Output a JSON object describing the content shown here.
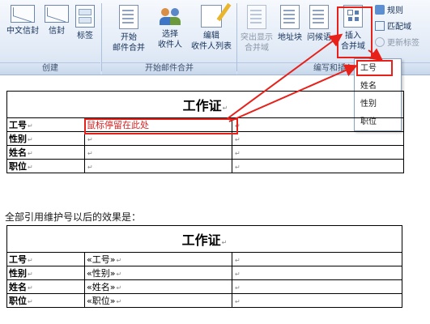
{
  "ribbon": {
    "groups": {
      "create": "创建",
      "start_merge": "开始邮件合并",
      "write_insert": "编写和插入"
    },
    "buttons": {
      "cn_envelope": "中文信封",
      "envelope": "信封",
      "labels": "标签",
      "start_merge": [
        "开始",
        "邮件合并"
      ],
      "select_recipients": [
        "选择",
        "收件人"
      ],
      "edit_recipients": [
        "编辑",
        "收件人列表"
      ],
      "highlight_fields": [
        "突出显示",
        "合并域"
      ],
      "address_block": "地址块",
      "greeting_line": "问候语",
      "insert_field": [
        "插入",
        "合并域"
      ]
    },
    "small_buttons": {
      "rules": "规则",
      "match_fields": "匹配域",
      "update_labels": "更新标签"
    }
  },
  "dropdown": {
    "items": [
      "工号",
      "姓名",
      "性别",
      "职位"
    ]
  },
  "table1": {
    "title": "工作证",
    "rows": [
      {
        "label": "工号",
        "value": "鼠标停留在此处"
      },
      {
        "label": "性别",
        "value": ""
      },
      {
        "label": "姓名",
        "value": ""
      },
      {
        "label": "职位",
        "value": ""
      }
    ]
  },
  "caption": "全部引用维护号以后的效果是：",
  "table2": {
    "title": "工作证",
    "rows": [
      {
        "label": "工号",
        "value": "«工号»"
      },
      {
        "label": "性别",
        "value": "«性别»"
      },
      {
        "label": "姓名",
        "value": "«姓名»"
      },
      {
        "label": "职位",
        "value": "«职位»"
      }
    ]
  },
  "colors": {
    "highlight_red": "#e8201a",
    "ribbon_blue": "#d6e2f2"
  },
  "icons": [
    "envelope-icon",
    "label-icon",
    "document-icon",
    "recipients-icon",
    "edit-list-icon",
    "insert-field-icon",
    "arrow-icon"
  ]
}
